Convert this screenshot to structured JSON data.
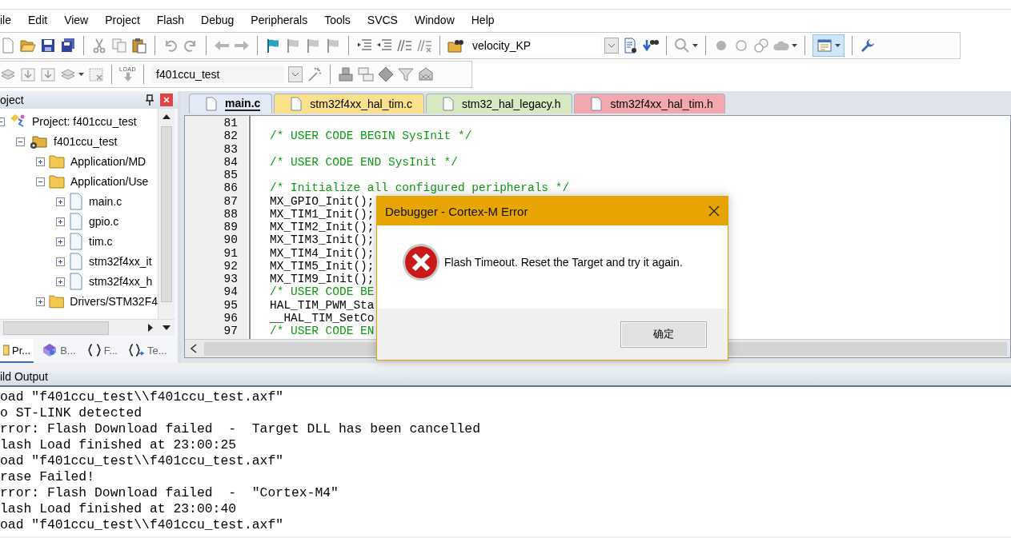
{
  "menu_bar": {
    "items": [
      "ile",
      "Edit",
      "View",
      "Project",
      "Flash",
      "Debug",
      "Peripherals",
      "Tools",
      "SVCS",
      "Window",
      "Help"
    ]
  },
  "toolbar_file": {
    "find_combo": {
      "value": "velocity_KP"
    },
    "window_button": {
      "pressed": true
    }
  },
  "toolbar_build": {
    "load_label": "LOAD",
    "target_combo": {
      "value": "f401ccu_test"
    }
  },
  "project_panel": {
    "title": "oject",
    "tree": [
      {
        "label": "Project: f401ccu_test",
        "kind": "project",
        "expanded": true,
        "children": [
          {
            "label": "f401ccu_test",
            "kind": "target",
            "expanded": true,
            "children": [
              {
                "label": "Application/MD",
                "kind": "group",
                "expanded": false
              },
              {
                "label": "Application/Use",
                "kind": "group",
                "expanded": true,
                "children": [
                  {
                    "label": "main.c",
                    "kind": "file",
                    "expanded": false
                  },
                  {
                    "label": "gpio.c",
                    "kind": "file",
                    "expanded": false
                  },
                  {
                    "label": "tim.c",
                    "kind": "file",
                    "expanded": false
                  },
                  {
                    "label": "stm32f4xx_it",
                    "kind": "file",
                    "expanded": false
                  },
                  {
                    "label": "stm32f4xx_h",
                    "kind": "file",
                    "expanded": false
                  }
                ]
              },
              {
                "label": "Drivers/STM32F4",
                "kind": "group",
                "expanded": false
              }
            ]
          }
        ]
      }
    ],
    "tabs": [
      {
        "label": "Pr...",
        "kind": "project",
        "selected": true
      },
      {
        "label": "B...",
        "kind": "books",
        "selected": false
      },
      {
        "label": "F...",
        "kind": "functions",
        "selected": false
      },
      {
        "label": "Te...",
        "kind": "templates",
        "selected": false
      }
    ]
  },
  "editor": {
    "tabs": [
      {
        "label": "main.c",
        "selected": true,
        "color": "#e3eaf5"
      },
      {
        "label": "stm32f4xx_hal_tim.c",
        "selected": false,
        "color": "#fbe18c"
      },
      {
        "label": "stm32_hal_legacy.h",
        "selected": false,
        "color": "#d6e9c0"
      },
      {
        "label": "stm32f4xx_hal_tim.h",
        "selected": false,
        "color": "#f3a7ae"
      }
    ],
    "lines": [
      {
        "number": "81"
      },
      {
        "number": "82",
        "kind": "comment",
        "text": "/* USER CODE BEGIN SysInit */"
      },
      {
        "number": "83"
      },
      {
        "number": "84",
        "kind": "comment",
        "text": "/* USER CODE END SysInit */"
      },
      {
        "number": "85"
      },
      {
        "number": "86",
        "kind": "comment",
        "text": "/* Initialize all configured peripherals */"
      },
      {
        "number": "87",
        "kind": "code",
        "text": "MX_GPIO_Init();"
      },
      {
        "number": "88",
        "kind": "code",
        "text": "MX_TIM1_Init();"
      },
      {
        "number": "89",
        "kind": "code",
        "text": "MX_TIM2_Init();"
      },
      {
        "number": "90",
        "kind": "code",
        "text": "MX_TIM3_Init();"
      },
      {
        "number": "91",
        "kind": "code",
        "text": "MX_TIM4_Init();"
      },
      {
        "number": "92",
        "kind": "code",
        "text": "MX_TIM5_Init();"
      },
      {
        "number": "93",
        "kind": "code",
        "text": "MX_TIM9_Init();"
      },
      {
        "number": "94",
        "kind": "comment",
        "text": "/* USER CODE BE"
      },
      {
        "number": "95",
        "kind": "code",
        "text": "HAL_TIM_PWM_Sta"
      },
      {
        "number": "96",
        "kind": "code",
        "text": "__HAL_TIM_SetCo"
      },
      {
        "number": "97",
        "kind": "comment",
        "text": "/* USER CODE EN"
      }
    ]
  },
  "build_output": {
    "title": "ild Output",
    "lines": [
      "oad \"f401ccu_test\\\\f401ccu_test.axf\"",
      "o ST-LINK detected",
      "rror: Flash Download failed  -  Target DLL has been cancelled",
      "lash Load finished at 23:00:25",
      "oad \"f401ccu_test\\\\f401ccu_test.axf\"",
      "rase Failed!",
      "rror: Flash Download failed  -  \"Cortex-M4\"",
      "lash Load finished at 23:00:40",
      "oad \"f401ccu_test\\\\f401ccu_test.axf\""
    ]
  },
  "dialog": {
    "title": "Debugger - Cortex-M Error",
    "message": "Flash Timeout. Reset the Target and try it again.",
    "buttons": [
      "确定"
    ]
  }
}
